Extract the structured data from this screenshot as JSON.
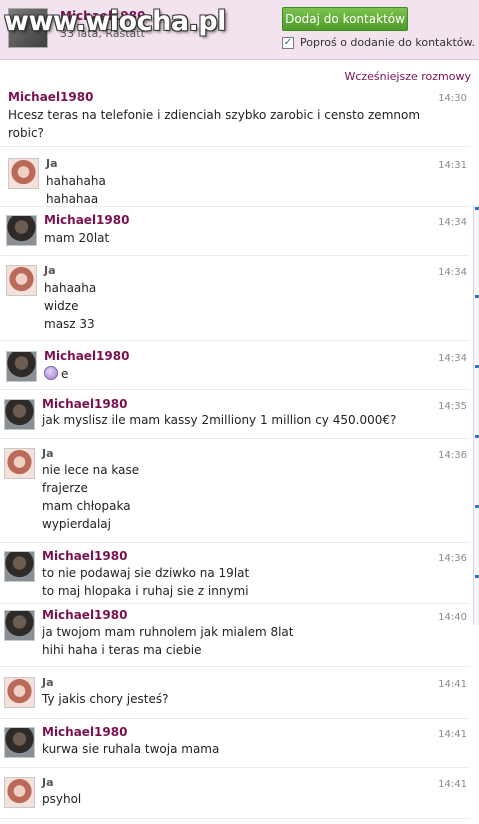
{
  "header": {
    "contact_name": "Michael1980",
    "contact_sub": "33 lata, Rastatt",
    "watermark": "www.wiocha.pl",
    "add_button": "Dodaj do kontaktów",
    "request_label": "Poproś o dodanie do kontaktów.",
    "request_checked": "✓"
  },
  "earlier_link": "Wcześniejsze rozmowy",
  "messages": [
    {
      "author": "Michael1980",
      "time": "14:30",
      "text": "Hcesz teras na telefonie i zdienciah szybko zarobic i censto zemnom robic?"
    },
    {
      "author": "Ja",
      "time": "14:31",
      "text": "hahahaha\nhahahaa"
    },
    {
      "author": "Michael1980",
      "time": "14:34",
      "text": "mam 20lat"
    },
    {
      "author": "Ja",
      "time": "14:34",
      "text": "hahaaha\nwidze\nmasz 33"
    },
    {
      "author": "Michael1980",
      "time": "14:34",
      "text": "e"
    },
    {
      "author": "Michael1980",
      "time": "14:35",
      "text": "jak myslisz ile mam kassy 2milliony 1 million cy  450.000€?"
    },
    {
      "author": "Ja",
      "time": "14:36",
      "text": "nie lece na kase\nfrajerze\nmam chłopaka\nwypierdalaj"
    },
    {
      "author": "Michael1980",
      "time": "14:36",
      "text": "to nie podawaj sie dziwko na 19lat\nto maj hlopaka i ruhaj sie z innymi"
    },
    {
      "author": "Michael1980",
      "time": "14:40",
      "text": "ja twojom mam ruhnolem jak mialem 8lat\nhihi haha i teras ma ciebie"
    },
    {
      "author": "Ja",
      "time": "14:41",
      "text": "Ty jakis chory jesteś?"
    },
    {
      "author": "Michael1980",
      "time": "14:41",
      "text": "kurwa sie ruhala twoja mama"
    },
    {
      "author": "Ja",
      "time": "14:41",
      "text": "psyhol"
    }
  ]
}
